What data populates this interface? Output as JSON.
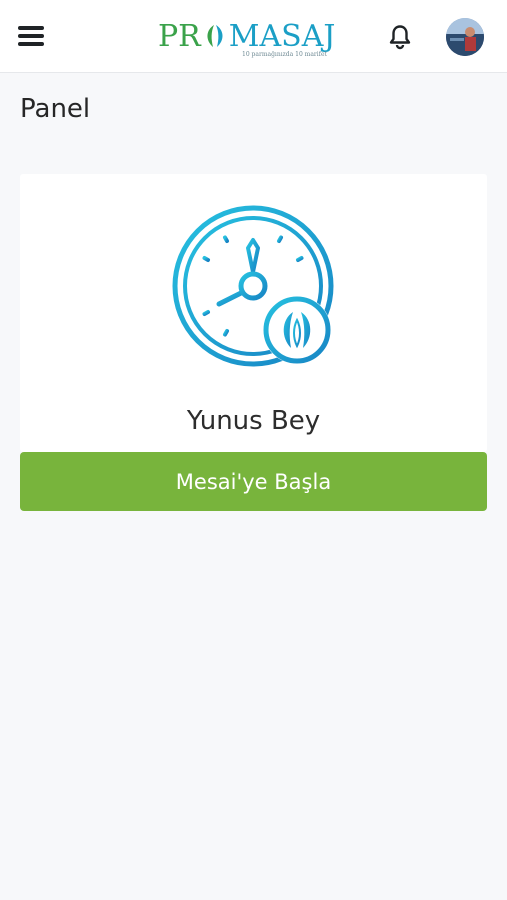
{
  "header": {
    "logo": {
      "part1": "PR",
      "part2": "MASAJ",
      "tagline": "10 parmağınızda 10 marifet"
    },
    "menu_icon": "hamburger-menu-icon",
    "notification_icon": "bell-icon",
    "avatar_icon": "user-avatar"
  },
  "page": {
    "title": "Panel"
  },
  "card": {
    "icon": "clock-icon",
    "user_name": "Yunus Bey"
  },
  "actions": {
    "start_shift_label": "Mesai'ye Başla"
  },
  "colors": {
    "accent_green": "#78b43c",
    "icon_blue": "#1b9fc6",
    "logo_green": "#3aa24a"
  }
}
